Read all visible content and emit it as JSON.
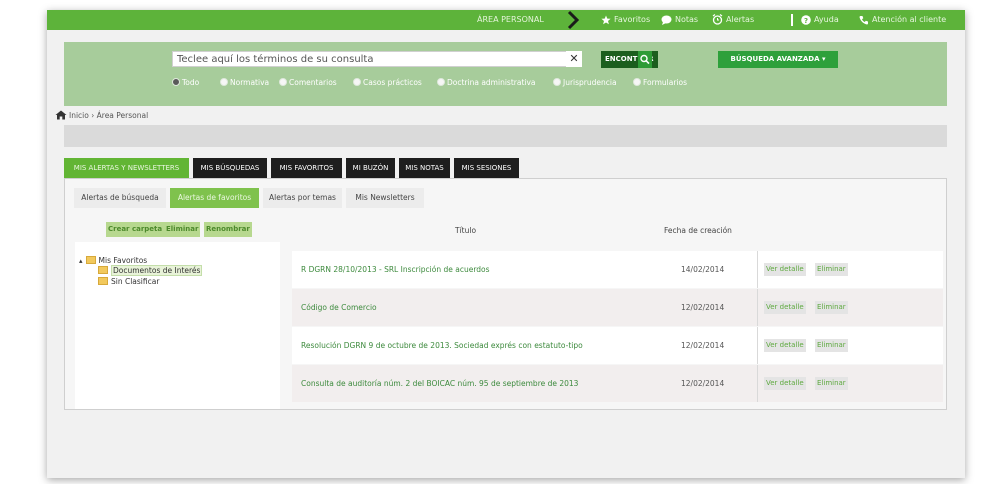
{
  "topbar": {
    "area_label": "ÁREA PERSONAL",
    "favoritos": "Favoritos",
    "notas": "Notas",
    "alertas": "Alertas",
    "ayuda": "Ayuda",
    "atencion": "Atención al cliente"
  },
  "search": {
    "placeholder": "Teclee aquí los términos de su consulta",
    "find_label": "ENCONTRAR",
    "advanced_label": "BÚSQUEDA AVANZADA ▾",
    "filters": [
      "Todo",
      "Normativa",
      "Comentarios",
      "Casos prácticos",
      "Doctrina administrativa",
      "Jurisprudencia",
      "Formularios"
    ],
    "selected_filter": "Todo"
  },
  "breadcrumb": {
    "home": "Inicio",
    "separator": "›",
    "current": "Área Personal"
  },
  "main_tabs": [
    {
      "label": "MIS ALERTAS Y NEWSLETTERS",
      "active": true
    },
    {
      "label": "MIS BÚSQUEDAS",
      "active": false
    },
    {
      "label": "MIS FAVORITOS",
      "active": false
    },
    {
      "label": "MI BUZÓN",
      "active": false
    },
    {
      "label": "MIS NOTAS",
      "active": false
    },
    {
      "label": "MIS SESIONES",
      "active": false
    }
  ],
  "sub_tabs": [
    {
      "label": "Alertas de búsqueda",
      "active": false
    },
    {
      "label": "Alertas de favoritos",
      "active": true
    },
    {
      "label": "Alertas por temas",
      "active": false
    },
    {
      "label": "Mis Newsletters",
      "active": false
    }
  ],
  "folder_actions": {
    "create": "Crear carpeta",
    "delete": "Eliminar",
    "rename": "Renombrar"
  },
  "tree": {
    "expander": "▴",
    "root": "Mis Favoritos",
    "children": [
      "Documentos de Interés",
      "Sin Clasificar"
    ],
    "selected": "Documentos de Interés"
  },
  "table": {
    "col_title": "Título",
    "col_date": "Fecha de creación",
    "action_detail": "Ver detalle",
    "action_delete": "Eliminar",
    "rows": [
      {
        "title": "R DGRN 28/10/2013 - SRL Inscripción de acuerdos",
        "date": "14/02/2014"
      },
      {
        "title": "Código de Comercio",
        "date": "12/02/2014"
      },
      {
        "title": "Resolución DGRN 9 de octubre de 2013. Sociedad exprés con estatuto-tipo",
        "date": "12/02/2014"
      },
      {
        "title": "Consulta de auditoría núm. 2 del BOICAC núm. 95 de septiembre de 2013",
        "date": "12/02/2014"
      }
    ]
  },
  "colors": {
    "brand_green": "#5db33a",
    "dark_green": "#1c5e1e",
    "search_panel": "#a7cc9b",
    "tab_dark": "#1e1e1e",
    "link_green": "#3d8a3d"
  }
}
